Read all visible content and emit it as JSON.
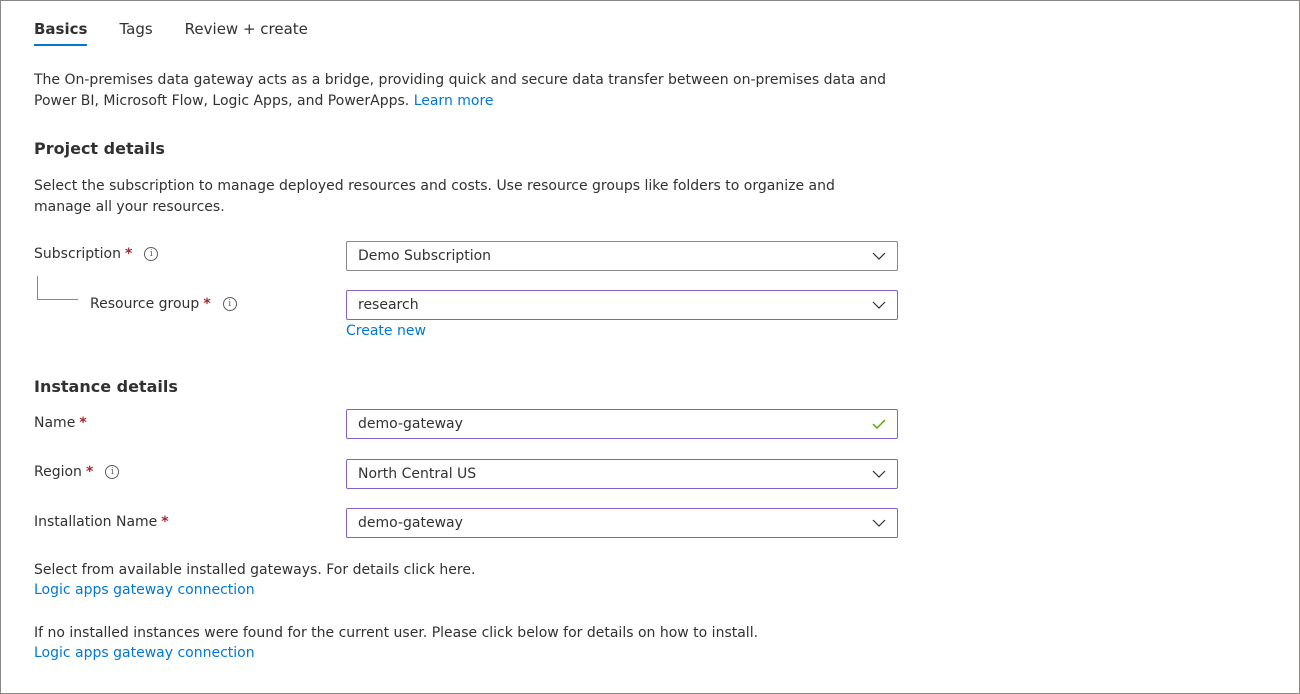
{
  "tabs": [
    {
      "label": "Basics",
      "active": true
    },
    {
      "label": "Tags",
      "active": false
    },
    {
      "label": "Review + create",
      "active": false
    }
  ],
  "intro": {
    "text": "The On-premises data gateway acts as a bridge, providing quick and secure data transfer between on-premises data and Power BI, Microsoft Flow, Logic Apps, and PowerApps.",
    "link": "Learn more"
  },
  "project": {
    "title": "Project details",
    "description": "Select the subscription to manage deployed resources and costs. Use resource groups like folders to organize and manage all your resources.",
    "subscription": {
      "label": "Subscription",
      "required": "*",
      "value": "Demo Subscription"
    },
    "resource_group": {
      "label": "Resource group",
      "required": "*",
      "value": "research",
      "create_new": "Create new"
    }
  },
  "instance": {
    "title": "Instance details",
    "name": {
      "label": "Name",
      "required": "*",
      "value": "demo-gateway"
    },
    "region": {
      "label": "Region",
      "required": "*",
      "value": "North Central US"
    },
    "installation_name": {
      "label": "Installation Name",
      "required": "*",
      "value": "demo-gateway"
    }
  },
  "notes": {
    "select_text": "Select from available installed gateways. For details click here.",
    "select_link": "Logic apps gateway connection",
    "none_text": "If no installed instances were found for the current user. Please click below for details on how to install.",
    "none_link": "Logic apps gateway connection"
  },
  "icons": {
    "info": "info-icon",
    "chevron": "chevron-down-icon",
    "check": "checkmark-icon"
  },
  "colors": {
    "accent": "#0078d4",
    "required": "#a4262c",
    "focus_border": "#8661c5",
    "valid": "#57a300"
  }
}
